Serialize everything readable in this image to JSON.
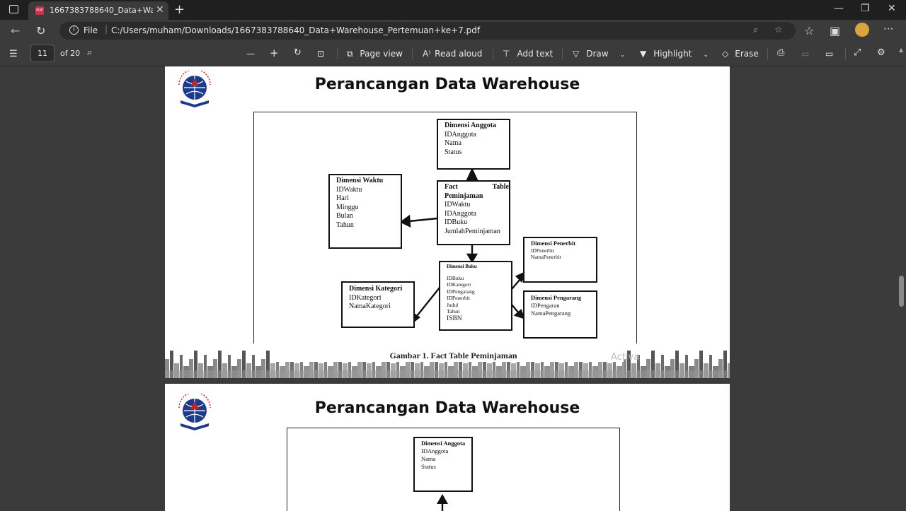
{
  "browser": {
    "tab_title": "1667383788640_Data+Warehouse_Pertemuan+ke+7.pdf",
    "scheme": "File",
    "url": "C:/Users/muham/Downloads/1667383788640_Data+Warehouse_Pertemuan+ke+7.pdf"
  },
  "pdf_toolbar": {
    "current_page": "11",
    "page_total": "of 20",
    "page_view": "Page view",
    "read_aloud": "Read aloud",
    "add_text": "Add text",
    "draw": "Draw",
    "highlight": "Highlight",
    "erase": "Erase"
  },
  "page1": {
    "title": "Perancangan Data Warehouse",
    "caption": "Gambar 1. Fact Table Peminjaman",
    "watermark": "Activa",
    "entities": {
      "anggota": {
        "title": "Dimensi Anggota",
        "fields": [
          "IDAnggota",
          "Nama",
          "Status"
        ]
      },
      "waktu": {
        "title": "Dimensi Waktu",
        "fields": [
          "IDWaktu",
          "Hari",
          "Minggu",
          "Bulan",
          "Tahun"
        ]
      },
      "fact": {
        "title_a": "Fact",
        "title_b": "Table",
        "title_c": "Peminjaman",
        "fields": [
          "IDWaktu",
          "IDAnggota",
          "IDBuku",
          "JumlahPeminjaman"
        ]
      },
      "penerbit": {
        "title": "Dimensi Penerbit",
        "fields": [
          "IDPenerbit",
          "NamaPenerbit"
        ]
      },
      "buku": {
        "title": "Dimensi Buku",
        "fields": [
          "IDBuku",
          "IDKategori",
          "IDPengarang",
          "IDPenerbit",
          "Judul",
          "Tahun",
          "ISBN"
        ]
      },
      "kategori": {
        "title": "Dimensi Kategori",
        "fields": [
          "IDKategori",
          "NamaKategori"
        ]
      },
      "pengarang": {
        "title": "Dimensi Pengarang",
        "fields": [
          "IDPengaran",
          "NamaPengarang"
        ]
      }
    }
  },
  "page2": {
    "title": "Perancangan Data Warehouse",
    "entities": {
      "anggota": {
        "title": "Dimensi Anggota",
        "fields": [
          "IDAnggota",
          "Nama",
          "Status"
        ]
      }
    }
  },
  "colors": {
    "chrome_dark": "#1f1f1f",
    "chrome": "#3b3b3b",
    "logo_blue": "#1e3a8a",
    "logo_red": "#c0272d"
  }
}
